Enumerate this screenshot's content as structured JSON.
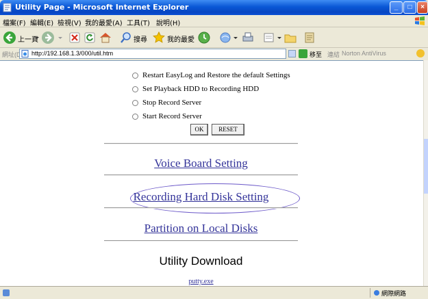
{
  "window": {
    "title": "Utility Page - Microsoft Internet Explorer"
  },
  "menu": [
    {
      "label": "檔案(F)"
    },
    {
      "label": "編輯(E)"
    },
    {
      "label": "檢視(V)"
    },
    {
      "label": "我的最愛(A)"
    },
    {
      "label": "工具(T)"
    },
    {
      "label": "說明(H)"
    }
  ],
  "toolbar": {
    "back_label": "上一頁",
    "search_label": "搜尋",
    "favorites_label": "我的最愛"
  },
  "addressbar": {
    "label": "網址(D)",
    "url": "http://192.168.1.3/000/util.htm",
    "go_label": "移至",
    "links_label": "連結",
    "norton_label": "Norton AntiVirus"
  },
  "page": {
    "options": [
      {
        "label": "Restart EasyLog and Restore the default Settings"
      },
      {
        "label": "Set Playback HDD to Recording HDD"
      },
      {
        "label": "Stop Record Server"
      },
      {
        "label": "Start Record Server"
      }
    ],
    "ok_label": "OK",
    "reset_label": "RESET",
    "links": [
      {
        "label": "Voice Board Setting"
      },
      {
        "label": "Recording Hard Disk Setting"
      },
      {
        "label": "Partition on Local Disks"
      }
    ],
    "download_heading": "Utility Download",
    "download_link": "putty.exe"
  },
  "status": {
    "zone_label": "網際網路"
  },
  "colors": {
    "link": "#333399",
    "titlebar": "#0a58d6",
    "highlight_oval": "#6a57c8"
  }
}
